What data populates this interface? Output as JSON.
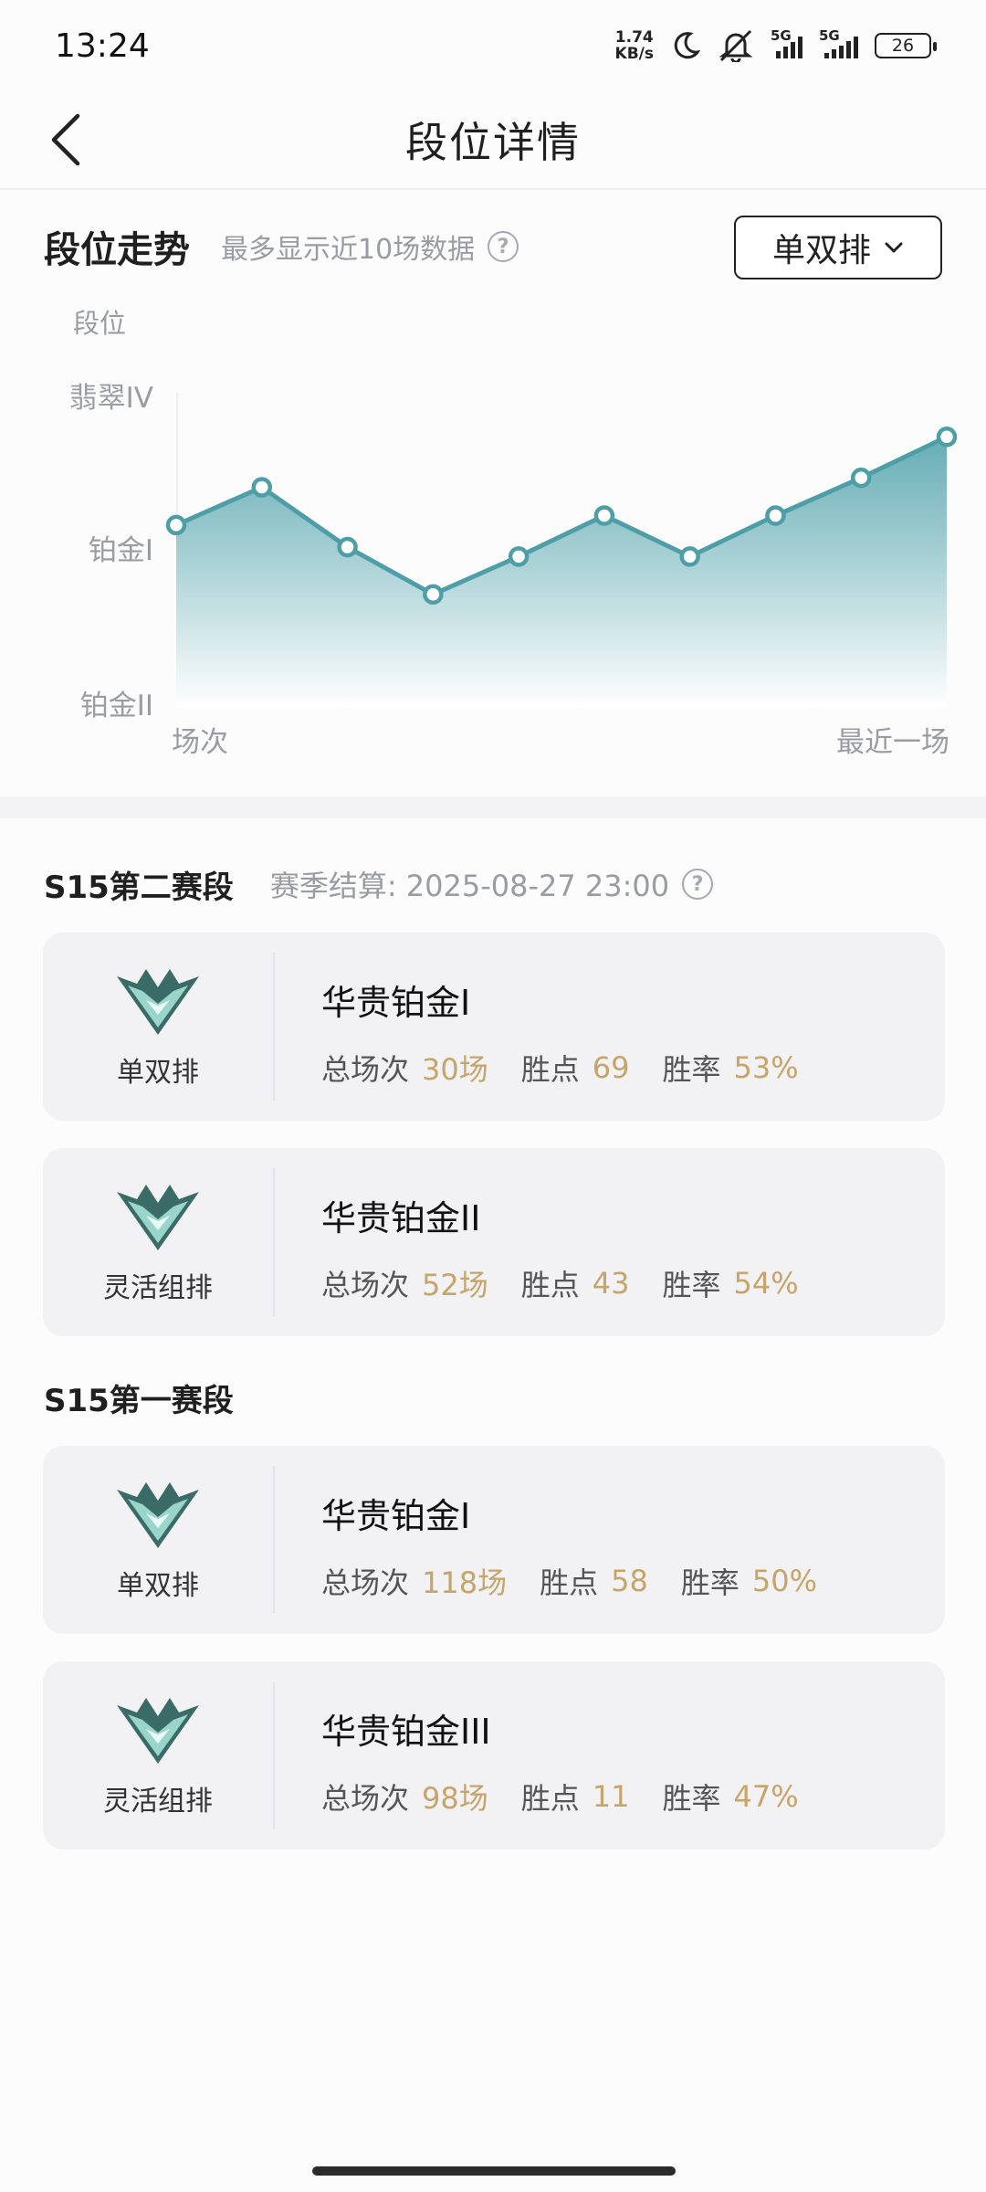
{
  "status_bar": {
    "time": "13:24",
    "net_speed_value": "1.74",
    "net_speed_unit": "KB/s",
    "network_1": "5G",
    "network_2": "5G",
    "battery": "26",
    "icons": [
      "moon-icon",
      "mute-bell-icon",
      "signal-icon",
      "battery-icon"
    ]
  },
  "header": {
    "title": "段位详情",
    "back_icon": "chevron-left-icon"
  },
  "trend": {
    "title": "段位走势",
    "hint": "最多显示近10场数据",
    "mode_select": "单双排"
  },
  "chart_data": {
    "type": "area",
    "ylabel": "段位",
    "y_ticks": [
      "翡翠IV",
      "铂金I",
      "铂金II"
    ],
    "x_start_label": "场次",
    "x_end_label": "最近一场",
    "values": [
      0.58,
      0.7,
      0.51,
      0.36,
      0.48,
      0.61,
      0.48,
      0.61,
      0.73,
      0.86
    ],
    "colors": {
      "line": "#4e9ea8",
      "fill_top": "#79b6bd",
      "fill_bottom": "#ffffff",
      "axis_text": "#9a9ca3"
    }
  },
  "seasons": [
    {
      "title": "S15第二赛段",
      "subtitle": "赛季结算: 2025-08-27 23:00",
      "cards": [
        {
          "mode": "单双排",
          "rank": "华贵铂金I",
          "games_label": "总场次",
          "games": "30场",
          "points_label": "胜点",
          "points": "69",
          "winrate_label": "胜率",
          "winrate": "53%"
        },
        {
          "mode": "灵活组排",
          "rank": "华贵铂金II",
          "games_label": "总场次",
          "games": "52场",
          "points_label": "胜点",
          "points": "43",
          "winrate_label": "胜率",
          "winrate": "54%"
        }
      ]
    },
    {
      "title": "S15第一赛段",
      "subtitle": "",
      "cards": [
        {
          "mode": "单双排",
          "rank": "华贵铂金I",
          "games_label": "总场次",
          "games": "118场",
          "points_label": "胜点",
          "points": "58",
          "winrate_label": "胜率",
          "winrate": "50%"
        },
        {
          "mode": "灵活组排",
          "rank": "华贵铂金III",
          "games_label": "总场次",
          "games": "98场",
          "points_label": "胜点",
          "points": "11",
          "winrate_label": "胜率",
          "winrate": "47%"
        }
      ]
    }
  ],
  "colors": {
    "accent_value": "#c6a46a",
    "card_bg": "#f2f2f5",
    "chart_teal": "#4e9ea8"
  }
}
